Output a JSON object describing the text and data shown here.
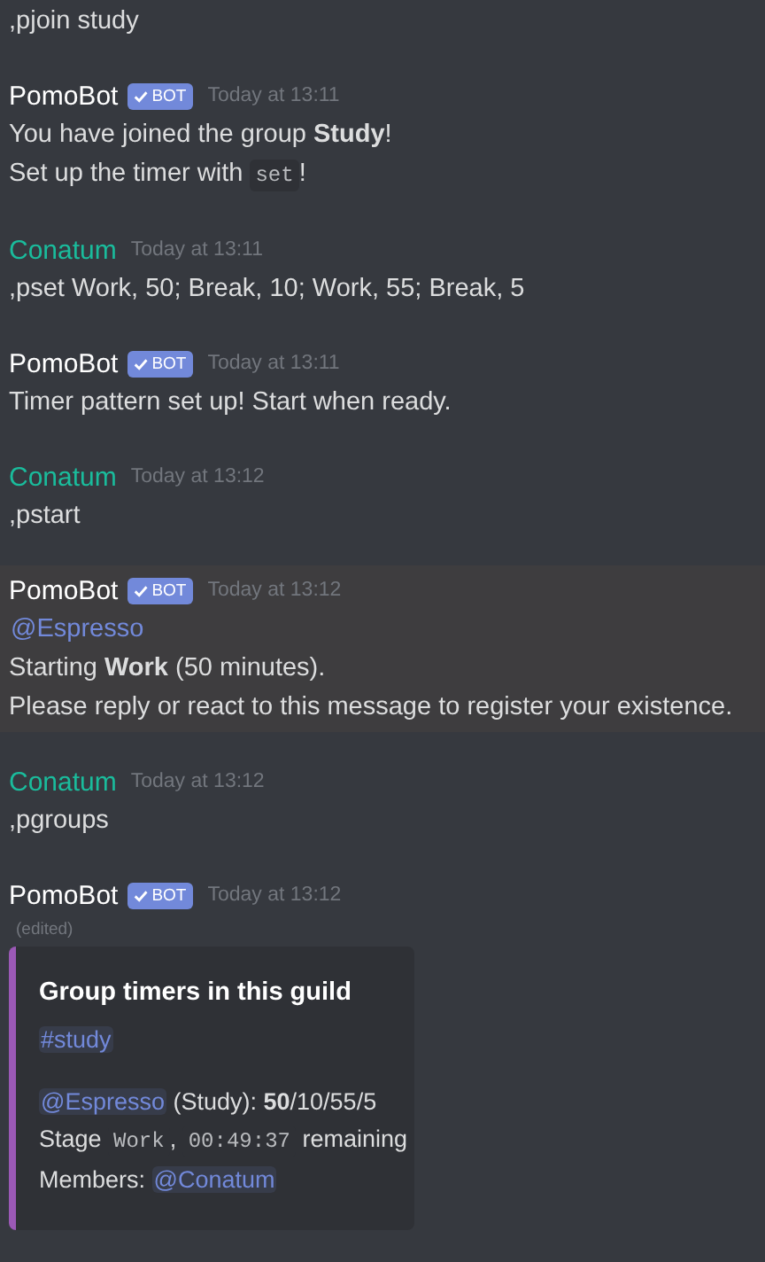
{
  "messages": [
    {
      "lines": [
        [
          {
            "kind": "text",
            "text": ",pjoin study"
          }
        ]
      ]
    },
    {
      "author": {
        "name": "PomoBot",
        "color": "#ffffff",
        "badge": "BOT"
      },
      "time": "Today at 13:11",
      "lines": [
        [
          {
            "kind": "text",
            "text": "You have joined the group **Study**!"
          }
        ],
        [
          {
            "kind": "text",
            "text": "Set up the timer with "
          },
          {
            "kind": "code",
            "text": "set"
          },
          {
            "kind": "text",
            "text": "!"
          }
        ]
      ]
    },
    {
      "author": {
        "name": "Conatum",
        "color": "#1abc9c"
      },
      "time": "Today at 13:11",
      "lines": [
        [
          {
            "kind": "text",
            "text": ",pset Work, 50; Break, 10; Work, 55; Break, 5"
          }
        ]
      ]
    },
    {
      "author": {
        "name": "PomoBot",
        "color": "#ffffff",
        "badge": "BOT"
      },
      "time": "Today at 13:11",
      "lines": [
        [
          {
            "kind": "text",
            "text": "Timer pattern set up! Start when ready."
          }
        ]
      ]
    },
    {
      "author": {
        "name": "Conatum",
        "color": "#1abc9c"
      },
      "time": "Today at 13:12",
      "lines": [
        [
          {
            "kind": "text",
            "text": ",pstart"
          }
        ]
      ]
    },
    {
      "author": {
        "name": "PomoBot",
        "color": "#ffffff",
        "badge": "BOT"
      },
      "time": "Today at 13:12",
      "highlighted": true,
      "lines": [
        [
          {
            "kind": "mention",
            "text": "@Espresso"
          }
        ],
        [
          {
            "kind": "text",
            "text": "Starting **Work** (50 minutes)."
          }
        ],
        [
          {
            "kind": "text",
            "text": "Please reply or react to this message to register your existence."
          }
        ]
      ]
    },
    {
      "author": {
        "name": "Conatum",
        "color": "#1abc9c"
      },
      "time": "Today at 13:12",
      "lines": [
        [
          {
            "kind": "text",
            "text": ",pgroups"
          }
        ]
      ]
    },
    {
      "author": {
        "name": "PomoBot",
        "color": "#ffffff",
        "badge": "BOT"
      },
      "time": "Today at 13:12",
      "edited": "(edited)",
      "embed": {
        "color": "#9b59b6",
        "title": "Group timers in this guild",
        "channel": "#study",
        "lines": [
          [
            {
              "kind": "mention",
              "text": "@Espresso"
            },
            {
              "kind": "text",
              "text": " (Study): **50**/10/55/5"
            }
          ],
          [
            {
              "kind": "text",
              "text": "Stage "
            },
            {
              "kind": "code",
              "text": "Work"
            },
            {
              "kind": "text",
              "text": ", "
            },
            {
              "kind": "code",
              "text": "00:49:37"
            },
            {
              "kind": "text",
              "text": " remaining"
            }
          ],
          [
            {
              "kind": "text",
              "text": "Members: "
            },
            {
              "kind": "mention",
              "text": "@Conatum"
            }
          ]
        ]
      }
    }
  ]
}
